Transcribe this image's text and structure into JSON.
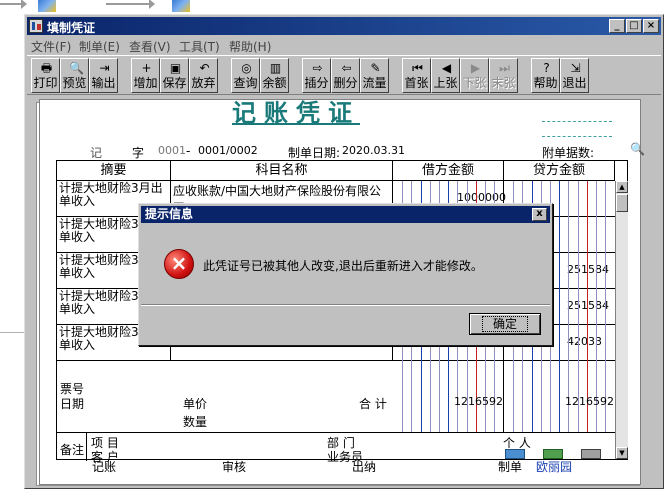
{
  "window": {
    "title": "填制凭证"
  },
  "menu": [
    {
      "label": "文件(F)"
    },
    {
      "label": "制单(E)"
    },
    {
      "label": "查看(V)"
    },
    {
      "label": "工具(T)"
    },
    {
      "label": "帮助(H)"
    }
  ],
  "toolbar": [
    {
      "label": "打印",
      "icon": "printer-icon",
      "glyph": "🖶",
      "enabled": true
    },
    {
      "label": "预览",
      "icon": "preview-icon",
      "glyph": "🔍",
      "enabled": true
    },
    {
      "label": "输出",
      "icon": "export-icon",
      "glyph": "⇥",
      "enabled": true
    },
    {
      "label": "增加",
      "icon": "add-icon",
      "glyph": "+",
      "enabled": true
    },
    {
      "label": "保存",
      "icon": "save-icon",
      "glyph": "▣",
      "enabled": true
    },
    {
      "label": "放弃",
      "icon": "undo-icon",
      "glyph": "↶",
      "enabled": true
    },
    {
      "label": "查询",
      "icon": "binoculars-icon",
      "glyph": "◎",
      "enabled": true
    },
    {
      "label": "余额",
      "icon": "chart-icon",
      "glyph": "▥",
      "enabled": true
    },
    {
      "label": "插分",
      "icon": "insert-row-icon",
      "glyph": "⇨",
      "enabled": true
    },
    {
      "label": "删分",
      "icon": "delete-row-icon",
      "glyph": "⇦",
      "enabled": true
    },
    {
      "label": "流量",
      "icon": "pencil-icon",
      "glyph": "✎",
      "enabled": true
    },
    {
      "label": "首张",
      "icon": "first-icon",
      "glyph": "⏮",
      "enabled": true
    },
    {
      "label": "上张",
      "icon": "prev-icon",
      "glyph": "◀",
      "enabled": true
    },
    {
      "label": "下张",
      "icon": "next-icon",
      "glyph": "▶",
      "enabled": false
    },
    {
      "label": "末张",
      "icon": "last-icon",
      "glyph": "⏭",
      "enabled": false
    },
    {
      "label": "帮助",
      "icon": "help-icon",
      "glyph": "?",
      "enabled": true
    },
    {
      "label": "退出",
      "icon": "exit-icon",
      "glyph": "⇲",
      "enabled": true
    }
  ],
  "voucher": {
    "title": "记账凭证",
    "type_char": "记",
    "zi": "字",
    "number": "0001",
    "dash": "-",
    "sub_number": "0001/0002",
    "date_label": "制单日期:",
    "date": "2020.03.31",
    "attachments_label": "附单据数:",
    "headers": {
      "summary": "摘要",
      "account": "科目名称",
      "debit": "借方金额",
      "credit": "贷方金额"
    },
    "rows": [
      {
        "summary": "计提大地财险3月出单收入",
        "account": "应收账款/中国大地财产保险股份有限公司",
        "debit": "1000000",
        "credit": ""
      },
      {
        "summary": "计提大地财险3月出单收入",
        "account": "",
        "debit": "",
        "credit": ""
      },
      {
        "summary": "计提大地财险3月出单收入",
        "account": "",
        "debit": "",
        "credit": "251584"
      },
      {
        "summary": "计提大地财险3月出单收入",
        "account": "",
        "debit": "",
        "credit": "251584"
      },
      {
        "summary": "计提大地财险3月出单收入",
        "account": "",
        "debit": "",
        "credit": "42033"
      }
    ],
    "ticket_label": "票号",
    "date_label2": "日期",
    "price_label": "单价",
    "qty_label": "数量",
    "total_label": "合 计",
    "total_debit": "1216592",
    "total_credit": "1216592",
    "remark_label": "备注",
    "project_label": "项  目",
    "customer_label": "客  户",
    "dept_label": "部  门",
    "salesman_label": "业务员",
    "person_label": "个  人"
  },
  "signatures": {
    "bookkeeping": "记账",
    "audit": "审核",
    "cashier": "出纳",
    "maker_label": "制单",
    "maker": "欧丽园"
  },
  "dialog": {
    "title": "提示信息",
    "message": "此凭证号已被其他人改变,退出后重新进入才能修改。",
    "ok": "确定",
    "close": "x"
  }
}
